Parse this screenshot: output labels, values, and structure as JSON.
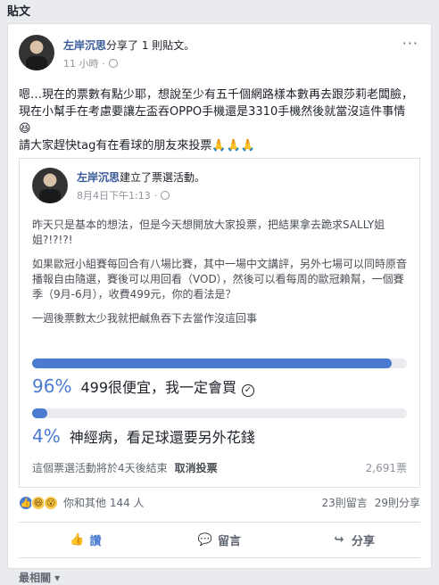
{
  "section": {
    "title": "貼文"
  },
  "post": {
    "author": "左岸沉思",
    "action": "分享了 1 則貼文。",
    "time": "11 小時",
    "more": "···",
    "text_lines": [
      "嗯…現在的票數有點少耶，想說至少有五千個網路樣本數再去跟莎莉老闆臉，現在小幫手在考慮要讓左盃吞OPPO手機還是3310手機然後就當沒這件事情😆",
      "請大家趕快tag有在看球的朋友來投票🙏🙏🙏"
    ]
  },
  "poll": {
    "author": "左岸沉思",
    "action": "建立了票選活動。",
    "time": "8月4日下午1:13",
    "paragraphs": [
      "昨天只是基本的想法，但是今天想開放大家投票，把結果拿去跪求SALLY姐姐?!?!?!",
      "如果歐冠小組賽每回合有八場比賽，其中一場中文講評，另外七場可以同時原音播報自由隨選，賽後可以用回看（VOD），然後可以看每周的歐冠賴幫，一個賽季（9月-6月），收費499元，你的看法是？",
      "一週後票數太少我就把鹹魚吞下去當作沒這回事"
    ],
    "options": [
      {
        "pct_label": "96%",
        "fraction": 0.96,
        "label": "499很便宜，我一定會買",
        "voted": true
      },
      {
        "pct_label": "4%",
        "fraction": 0.04,
        "label": "神經病，看足球還要另外花錢",
        "voted": false
      }
    ],
    "footer_text": "這個票選活動將於4天後結束",
    "cancel_label": "取消投票",
    "vote_count": "2,691票"
  },
  "stats": {
    "reactions_text": "你和其他 144 人",
    "comments": "23則留言",
    "shares": "29則分享"
  },
  "actions": {
    "like": "讚",
    "comment": "留言",
    "share": "分享"
  },
  "sort": {
    "label": "最相關 ▾"
  },
  "colors": {
    "accent": "#4a7bd0",
    "link": "#365899"
  }
}
